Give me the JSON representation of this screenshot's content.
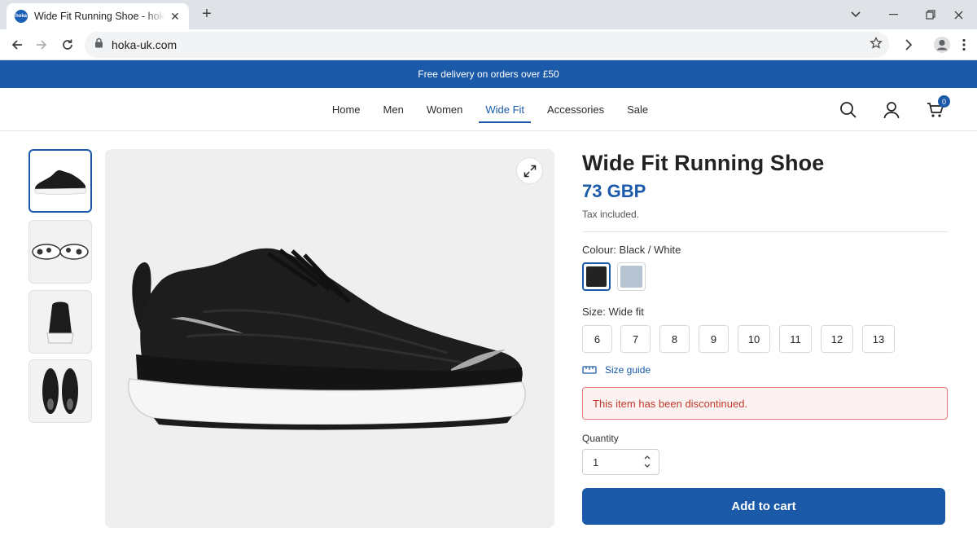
{
  "browser": {
    "tab_title": "Wide Fit Running Shoe - hoka-uk.com",
    "url": "hoka-uk.com",
    "favicon_text": "hoka"
  },
  "announcement": "Free delivery on orders over £50",
  "nav": {
    "items": [
      "Home",
      "Men",
      "Women",
      "Wide Fit",
      "Accessories",
      "Sale"
    ],
    "active": "Wide Fit"
  },
  "cart": {
    "count": "0"
  },
  "gallery": {
    "thumbnails": [
      "side view",
      "sole view",
      "heel view",
      "top view"
    ],
    "selected_index": 0
  },
  "product": {
    "title": "Wide Fit Running Shoe",
    "price": "73 GBP",
    "tax_note": "Tax included.",
    "colour_label": "Colour: Black / White",
    "colours": [
      {
        "name": "Black / White",
        "hex": "#232323",
        "selected": true
      },
      {
        "name": "Grey Blue",
        "hex": "#b7c4d1",
        "selected": false
      }
    ],
    "size_label": "Size: Wide fit",
    "sizes": [
      "6",
      "7",
      "8",
      "9",
      "10",
      "11",
      "12",
      "13"
    ],
    "size_guide": "Size guide",
    "alert": "This item has been discontinued.",
    "quantity_label": "Quantity",
    "quantity_value": "1",
    "add_to_cart": "Add to cart"
  },
  "colors": {
    "brand_blue": "#1a5aa8",
    "alert_red": "#c0392b"
  }
}
